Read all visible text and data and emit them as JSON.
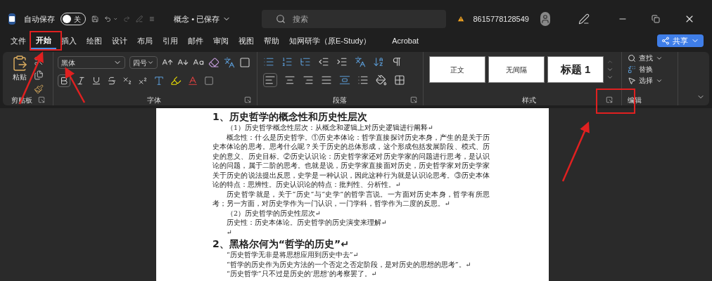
{
  "title_bar": {
    "autosave_label": "自动保存",
    "autosave": {
      "on": false,
      "label": "关"
    },
    "document_title": "概念 • 已保存",
    "search": {
      "placeholder": "搜索"
    },
    "account": "8615778128549"
  },
  "tabs": [
    {
      "label": "文件",
      "selected": false
    },
    {
      "label": "开始",
      "selected": true
    },
    {
      "label": "插入",
      "selected": false
    },
    {
      "label": "绘图",
      "selected": false
    },
    {
      "label": "设计",
      "selected": false
    },
    {
      "label": "布局",
      "selected": false
    },
    {
      "label": "引用",
      "selected": false
    },
    {
      "label": "邮件",
      "selected": false
    },
    {
      "label": "审阅",
      "selected": false
    },
    {
      "label": "视图",
      "selected": false
    },
    {
      "label": "帮助",
      "selected": false
    },
    {
      "label": "知网研学（原E-Study）",
      "selected": false
    },
    {
      "label": "Acrobat",
      "selected": false
    }
  ],
  "share_button": "共享",
  "ribbon": {
    "clipboard": {
      "paste": "粘贴",
      "label": "剪贴板"
    },
    "font": {
      "name": "黑体",
      "size": "四号",
      "label": "字体"
    },
    "paragraph": {
      "label": "段落"
    },
    "styles": {
      "items": [
        {
          "label": "正文",
          "kind": "plain"
        },
        {
          "label": "无间隔",
          "kind": "plain"
        },
        {
          "label": "标题 1",
          "kind": "heading"
        }
      ],
      "label": "样式"
    },
    "editing": {
      "items": [
        "查找",
        "替换",
        "选择"
      ],
      "label": "编辑"
    }
  },
  "document": [
    {
      "kind": "heading",
      "text": "1、历史哲学的概念性和历史性层次"
    },
    {
      "kind": "indent",
      "text": "（1）历史哲学概念性层次：从概念和逻辑上对历史逻辑进行阐释↵"
    },
    {
      "kind": "indent",
      "text": "概念性：什么是历史哲学。①历史本体论：哲学直接探讨历史本身，产生的是关于历史本体论的思考。思考什么呢？关于历史的总体形成，这个形成包括发展阶段、模式、历史的意义、历史目标。②历史认识论：历史哲学家还对历史学家的问题进行思考，是认识论的问题，属于二阶的思考。也就是说，历史学家直接面对历史，历史哲学家对历史学家关于历史的说法提出反思，史学是一种认识，因此这种行为就是认识论思考。③历史本体论的特点：思辨性。历史认识论的特点：批判性、分析性。↵"
    },
    {
      "kind": "indent",
      "text": "历史哲学就是，关于“历史”与“史学”的哲学言说。一方面对历史本身，哲学有所思考；另一方面，对历史学作为一门认识，一门学科，哲学作为二度的反思。↵"
    },
    {
      "kind": "indent",
      "text": "（2）历史哲学的历史性层次↵"
    },
    {
      "kind": "indent",
      "text": "历史性：历史本体论。历史哲学的历史演变来理解↵"
    },
    {
      "kind": "indent",
      "text": "↵"
    },
    {
      "kind": "heading",
      "text": "2、黑格尔何为“哲学的历史”↵"
    },
    {
      "kind": "indent",
      "text": "“历史哲学无非是将思想应用到历史中去”↵"
    },
    {
      "kind": "indent",
      "text": "“哲学的历史作为历史方法的一个否定之否定阶段，是对历史的思想的思考”。↵"
    },
    {
      "kind": "indent",
      "text": "“历史哲学”只不过是历史的‘思想’的考察罢了。↵"
    }
  ]
}
